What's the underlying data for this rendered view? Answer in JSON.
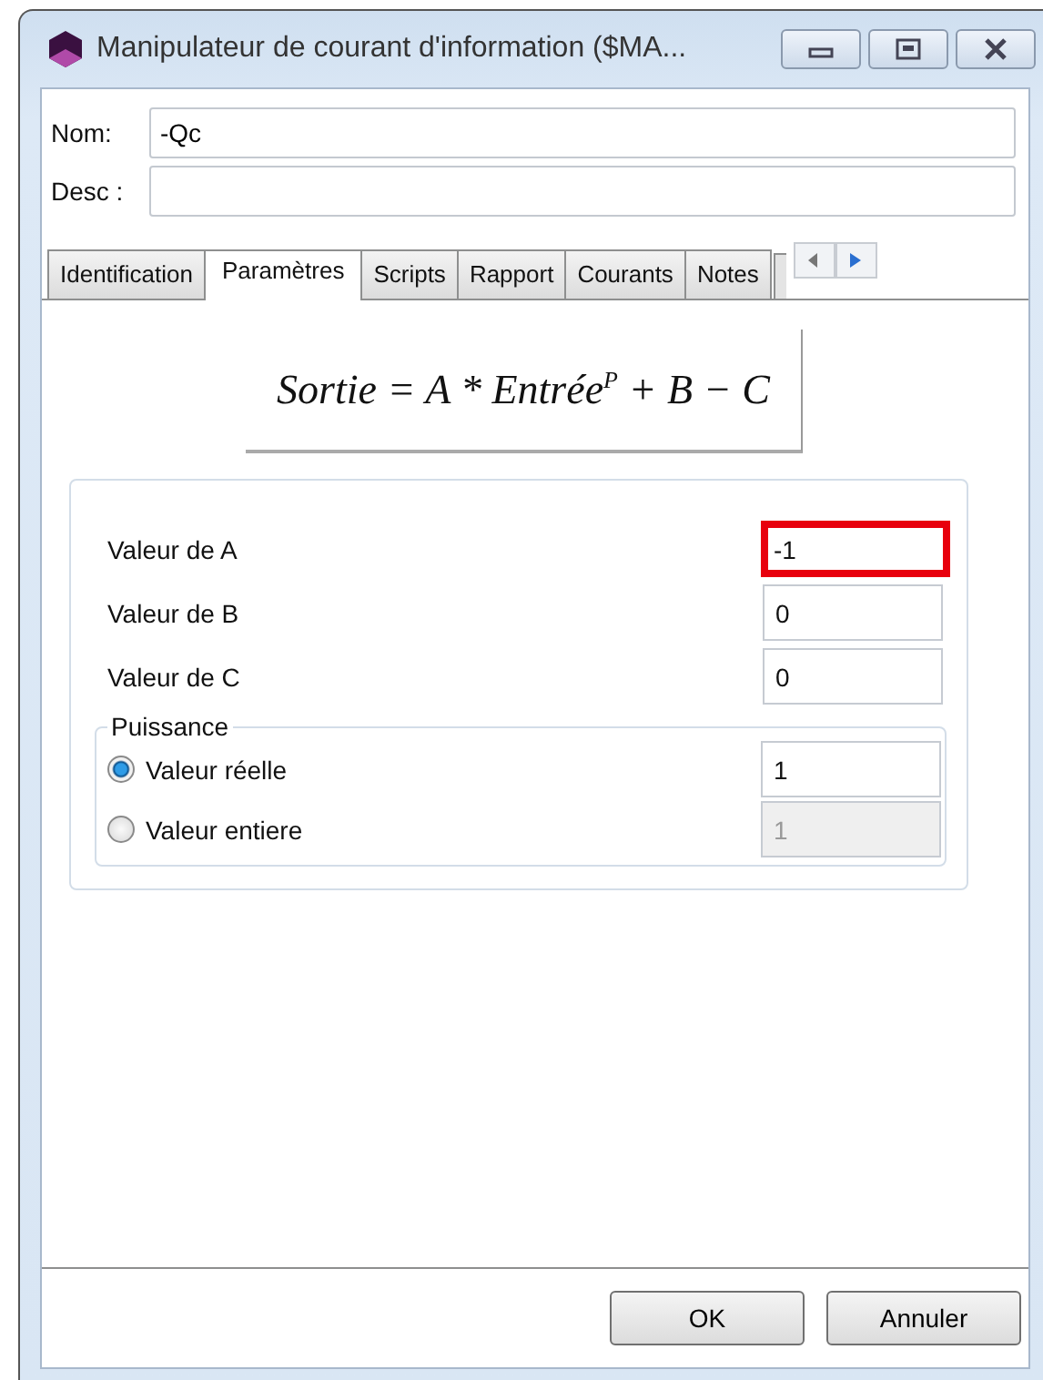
{
  "window": {
    "title": "Manipulateur de courant d'information ($MA..."
  },
  "header_fields": [
    {
      "label": "Nom:",
      "value": "-Qc"
    },
    {
      "label": "Desc :"
    }
  ],
  "tabs": [
    {
      "label": "Identification",
      "selected": false
    },
    {
      "label": "Paramètres",
      "selected": true
    },
    {
      "label": "Scripts",
      "selected": false
    },
    {
      "label": "Rapport",
      "selected": false
    },
    {
      "label": "Courants",
      "selected": false
    },
    {
      "label": "Notes",
      "selected": false
    }
  ],
  "formula": "Sortie = A * Entrée$^{P}$ + B − C",
  "parameters": [
    {
      "label": "Valeur de A",
      "value": "-1",
      "highlighted": true
    },
    {
      "label": "Valeur de B",
      "value": "0",
      "highlighted": false
    },
    {
      "label": "Valeur de C",
      "value": "0",
      "highlighted": false
    }
  ],
  "power_group": {
    "title": "Puissance",
    "options": [
      {
        "label": "Valeur réelle",
        "selected": true,
        "value": "1",
        "disabled": false
      },
      {
        "label": "Valeur entiere",
        "selected": false,
        "value": "1",
        "disabled": true
      }
    ]
  },
  "buttons": [
    "OK",
    "Annuler"
  ]
}
